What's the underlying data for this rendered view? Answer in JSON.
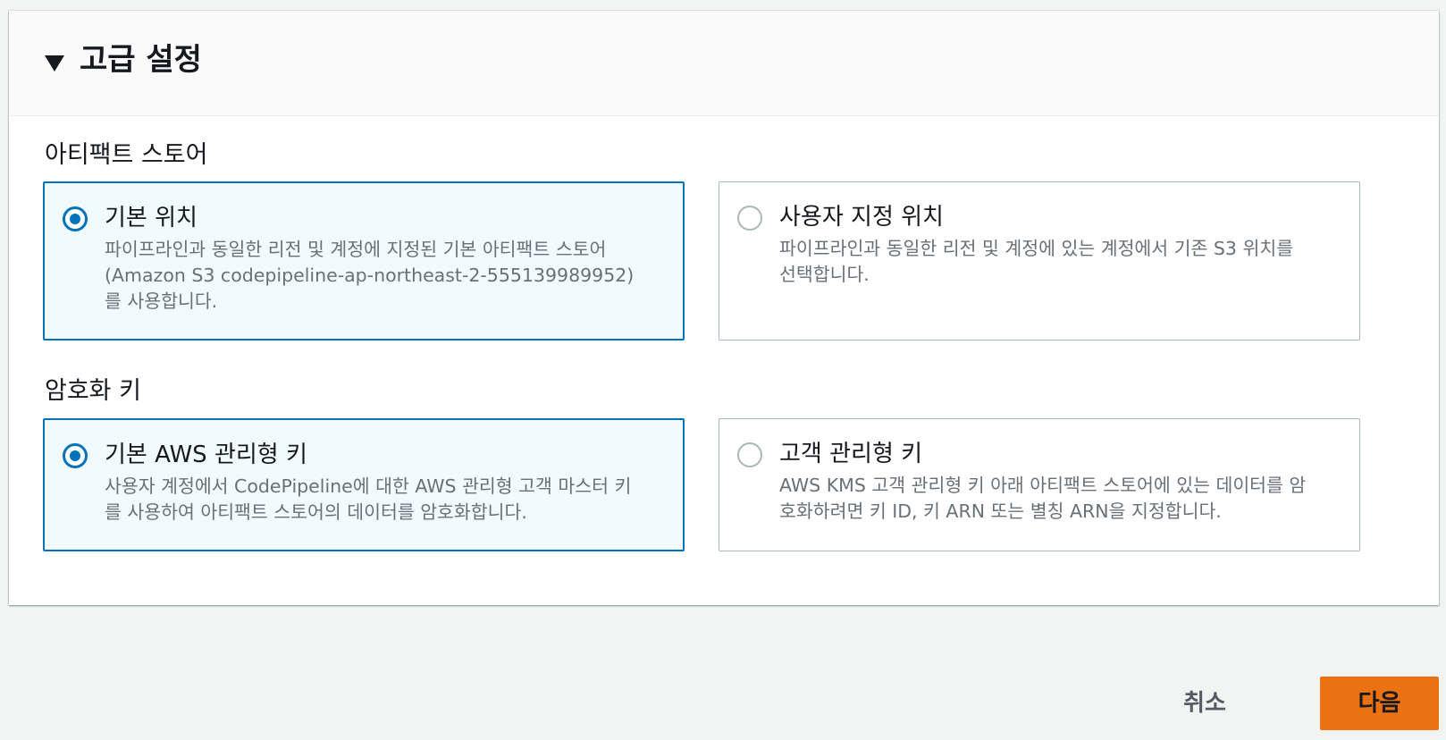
{
  "panel": {
    "title": "고급 설정",
    "expanded": true
  },
  "artifact_store": {
    "label": "아티팩트 스토어",
    "options": [
      {
        "title": "기본 위치",
        "description": "파이프라인과 동일한 리전 및 계정에 지정된 기본 아티팩트 스토어\n(Amazon S3 codepipeline-ap-northeast-2-555139989952)\n를 사용합니다.",
        "selected": true
      },
      {
        "title": "사용자 지정 위치",
        "description": "파이프라인과 동일한 리전 및 계정에 있는 계정에서 기존 S3 위치를\n선택합니다.",
        "selected": false
      }
    ]
  },
  "encryption_key": {
    "label": "암호화 키",
    "options": [
      {
        "title": "기본 AWS 관리형 키",
        "description": "사용자 계정에서 CodePipeline에 대한 AWS 관리형 고객 마스터 키\n를 사용하여 아티팩트 스토어의 데이터를 암호화합니다.",
        "selected": true
      },
      {
        "title": "고객 관리형 키",
        "description": "AWS KMS 고객 관리형 키 아래 아티팩트 스토어에 있는 데이터를 암\n호화하려면 키 ID, 키 ARN 또는 별칭 ARN을 지정합니다.",
        "selected": false
      }
    ]
  },
  "footer": {
    "cancel_label": "취소",
    "next_label": "다음"
  },
  "colors": {
    "accent": "#0073bb",
    "primary_button": "#ec7211",
    "background": "#f2f3f3"
  }
}
